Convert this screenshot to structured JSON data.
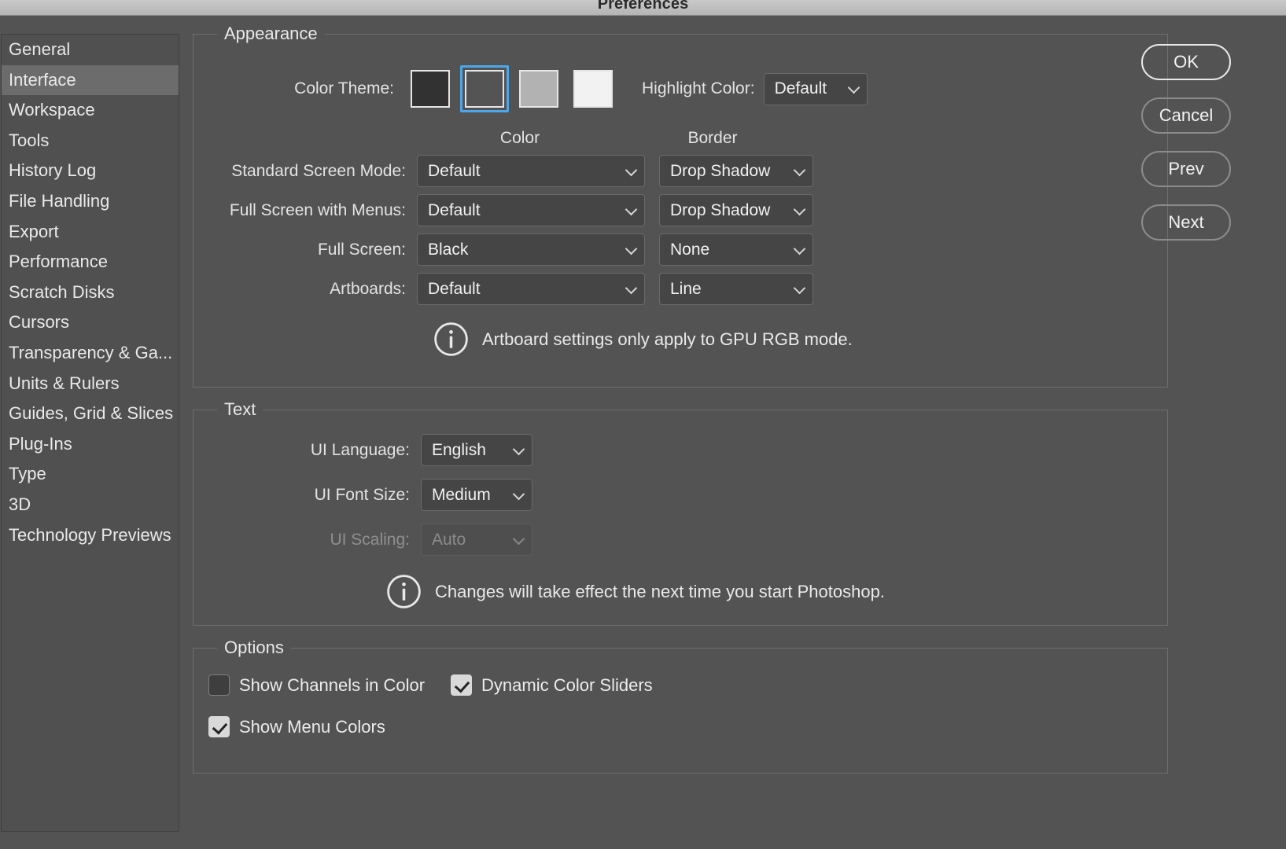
{
  "window": {
    "title": "Preferences"
  },
  "sidebar": {
    "items": [
      {
        "label": "General",
        "selected": false
      },
      {
        "label": "Interface",
        "selected": true
      },
      {
        "label": "Workspace",
        "selected": false
      },
      {
        "label": "Tools",
        "selected": false
      },
      {
        "label": "History Log",
        "selected": false
      },
      {
        "label": "File Handling",
        "selected": false
      },
      {
        "label": "Export",
        "selected": false
      },
      {
        "label": "Performance",
        "selected": false
      },
      {
        "label": "Scratch Disks",
        "selected": false
      },
      {
        "label": "Cursors",
        "selected": false
      },
      {
        "label": "Transparency & Ga...",
        "selected": false
      },
      {
        "label": "Units & Rulers",
        "selected": false
      },
      {
        "label": "Guides, Grid & Slices",
        "selected": false
      },
      {
        "label": "Plug-Ins",
        "selected": false
      },
      {
        "label": "Type",
        "selected": false
      },
      {
        "label": "3D",
        "selected": false
      },
      {
        "label": "Technology Previews",
        "selected": false
      }
    ]
  },
  "appearance": {
    "legend": "Appearance",
    "color_theme_label": "Color Theme:",
    "color_theme_swatches": [
      {
        "name": "darkest",
        "color": "#323232",
        "selected": false
      },
      {
        "name": "dark",
        "color": "#545454",
        "selected": true
      },
      {
        "name": "medium",
        "color": "#b2b2b2",
        "selected": false
      },
      {
        "name": "light",
        "color": "#f2f2f2",
        "selected": false
      }
    ],
    "highlight_color_label": "Highlight Color:",
    "highlight_color_value": "Default",
    "column_headers": {
      "color": "Color",
      "border": "Border"
    },
    "rows": [
      {
        "label": "Standard Screen Mode:",
        "color": "Default",
        "border": "Drop Shadow"
      },
      {
        "label": "Full Screen with Menus:",
        "color": "Default",
        "border": "Drop Shadow"
      },
      {
        "label": "Full Screen:",
        "color": "Black",
        "border": "None"
      },
      {
        "label": "Artboards:",
        "color": "Default",
        "border": "Line"
      }
    ],
    "note": "Artboard settings only apply to GPU RGB mode."
  },
  "text_section": {
    "legend": "Text",
    "rows": [
      {
        "label": "UI Language:",
        "value": "English",
        "disabled": false
      },
      {
        "label": "UI Font Size:",
        "value": "Medium",
        "disabled": false
      },
      {
        "label": "UI Scaling:",
        "value": "Auto",
        "disabled": true
      }
    ],
    "note": "Changes will take effect the next time you start Photoshop."
  },
  "options": {
    "legend": "Options",
    "checkboxes": [
      {
        "label": "Show Channels in Color",
        "checked": false
      },
      {
        "label": "Dynamic Color Sliders",
        "checked": true
      },
      {
        "label": "Show Menu Colors",
        "checked": true
      }
    ]
  },
  "buttons": [
    {
      "label": "OK",
      "primary": true
    },
    {
      "label": "Cancel",
      "primary": false
    },
    {
      "label": "Prev",
      "primary": false
    },
    {
      "label": "Next",
      "primary": false
    }
  ],
  "colors": {
    "dialog_background": "#535353",
    "sidebar_background": "#505050",
    "sidebar_selected": "#6c6c6c",
    "field_background": "#454545",
    "accent_selection": "#4da6e8",
    "titlebar_background": "#bdbdbd"
  }
}
